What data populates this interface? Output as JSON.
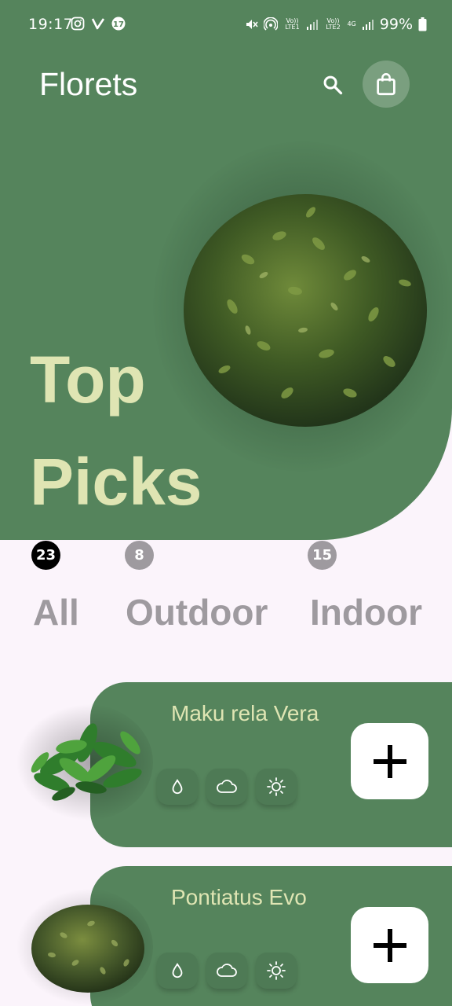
{
  "status_bar": {
    "time": "19:17",
    "left_icons": [
      "instagram-icon",
      "v-app-icon",
      "notification-app-icon"
    ],
    "network1": "Vo)) LTE1",
    "network2": "Vo)) LTE2",
    "net_type": "4G",
    "battery": "99%"
  },
  "header": {
    "title": "Florets",
    "search_icon": "search-icon",
    "cart_icon": "shopping-bag-icon"
  },
  "hero": {
    "heading_line1": "Top",
    "heading_line2": "Picks",
    "image": "round-shrub-image"
  },
  "categories": [
    {
      "label": "All",
      "count": "23",
      "active": true,
      "badge_color": "#000000"
    },
    {
      "label": "Outdoor",
      "count": "8",
      "active": false,
      "badge_color": "#9e9a9f"
    },
    {
      "label": "Indoor",
      "count": "15",
      "active": false,
      "badge_color": "#9e9a9f"
    }
  ],
  "products": [
    {
      "name": "Maku rela Vera",
      "image": "leafy-plant-image",
      "care_icons": [
        "water-drop-icon",
        "cloud-icon",
        "sun-icon"
      ],
      "add_icon": "plus-icon"
    },
    {
      "name": "Pontiatus Evo",
      "image": "shrub-image",
      "care_icons": [
        "water-drop-icon",
        "cloud-icon",
        "sun-icon"
      ],
      "add_icon": "plus-icon"
    }
  ],
  "colors": {
    "primary_green": "#55845c",
    "accent_cream": "#dfe5b3",
    "background": "#fbf4fb",
    "muted_text": "#9e9a9f"
  }
}
